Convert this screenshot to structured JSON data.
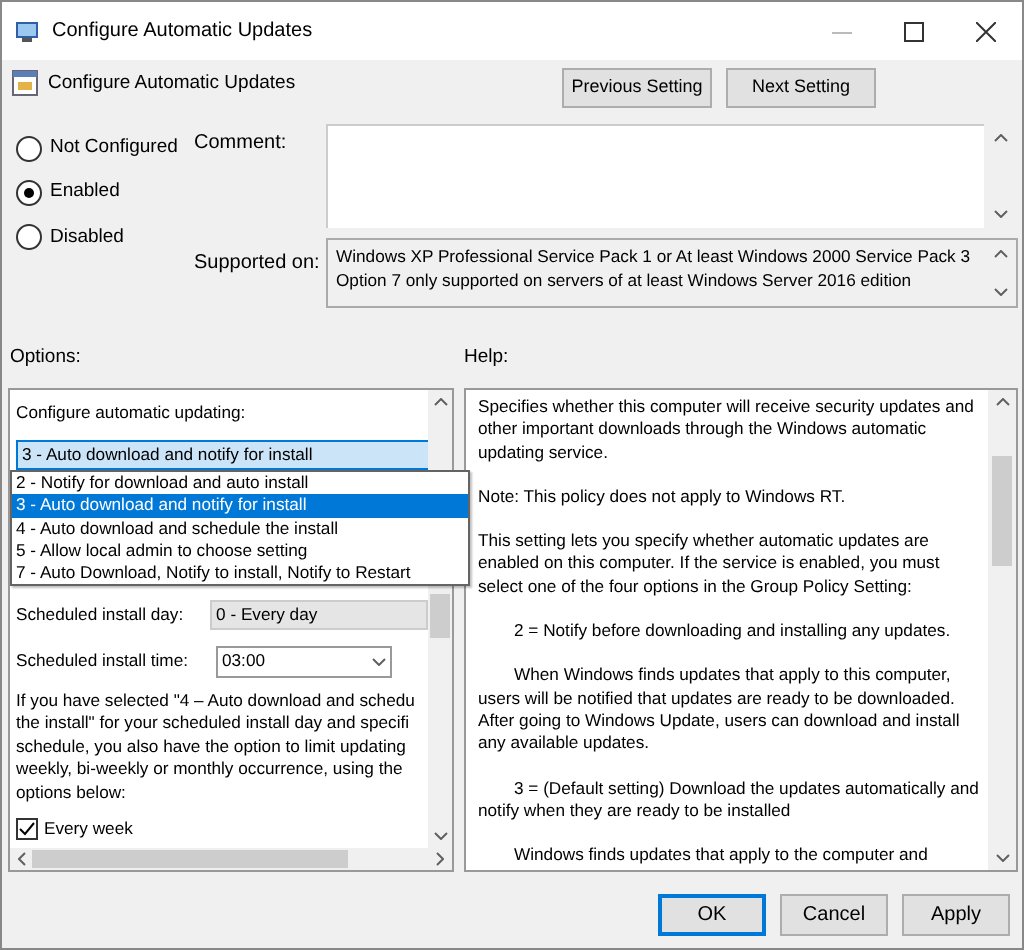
{
  "window": {
    "title": "Configure Automatic Updates"
  },
  "header": {
    "title": "Configure Automatic Updates",
    "buttons": [
      "Previous Setting",
      "Next Setting"
    ]
  },
  "state_options": [
    {
      "label": "Not Configured",
      "selected": false
    },
    {
      "label": "Enabled",
      "selected": true
    },
    {
      "label": "Disabled",
      "selected": false
    }
  ],
  "comment": {
    "label": "Comment:"
  },
  "supported_on": {
    "label": "Supported on:",
    "text": "Windows XP Professional Service Pack 1 or At least Windows 2000 Service Pack 3 Option 7 only supported on servers of at least Windows Server 2016 edition"
  },
  "options": {
    "label": "Options:",
    "heading": "Configure automatic updating:",
    "select": {
      "value": "3 - Auto download and notify for install",
      "expanded": true,
      "list": [
        {
          "label": "2 - Notify for download and auto install",
          "selected": false
        },
        {
          "label": "3 - Auto download and notify for install",
          "selected": true
        },
        {
          "label": "4 - Auto download and schedule the install",
          "selected": false
        },
        {
          "label": "5 - Allow local admin to choose setting",
          "selected": false
        },
        {
          "label": "7 - Auto Download, Notify to install, Notify to Restart",
          "selected": false
        }
      ]
    },
    "day": {
      "label": "Scheduled install day:",
      "value": "0 - Every day"
    },
    "time": {
      "label": "Scheduled install time:",
      "value": "03:00"
    },
    "note_lines": [
      "If you have selected \"4 – Auto download and schedu",
      "the install\" for your scheduled install day and specifi",
      "schedule, you also have the option to limit updating",
      "weekly, bi-weekly or monthly occurrence, using the",
      "options below:"
    ],
    "checkbox": {
      "label": "Every week",
      "checked": true
    }
  },
  "help": {
    "label": "Help:",
    "paragraphs": [
      {
        "text": "Specifies whether this computer will receive security updates and other important downloads through the Windows automatic updating service.",
        "kind": "plain"
      },
      {
        "text": "Note: This policy does not apply to Windows RT.",
        "kind": "plain"
      },
      {
        "text": "This setting lets you specify whether automatic updates are enabled on this computer. If the service is enabled, you must select one of the four options in the Group Policy Setting:",
        "kind": "plain"
      },
      {
        "text": "2 = Notify before downloading and installing any updates.",
        "kind": "indented"
      },
      {
        "text": "When Windows finds updates that apply to this computer, users will be notified that updates are ready to be downloaded. After going to Windows Update, users can download and install any available updates.",
        "kind": "indented"
      },
      {
        "text": "3 = (Default setting) Download the updates automatically and notify when they are ready to be installed",
        "kind": "indented"
      },
      {
        "text": "Windows finds updates that apply to the computer and",
        "kind": "indented"
      }
    ]
  },
  "dialog_buttons": [
    {
      "label": "OK",
      "default": true
    },
    {
      "label": "Cancel",
      "default": false
    },
    {
      "label": "Apply",
      "default": false
    }
  ]
}
